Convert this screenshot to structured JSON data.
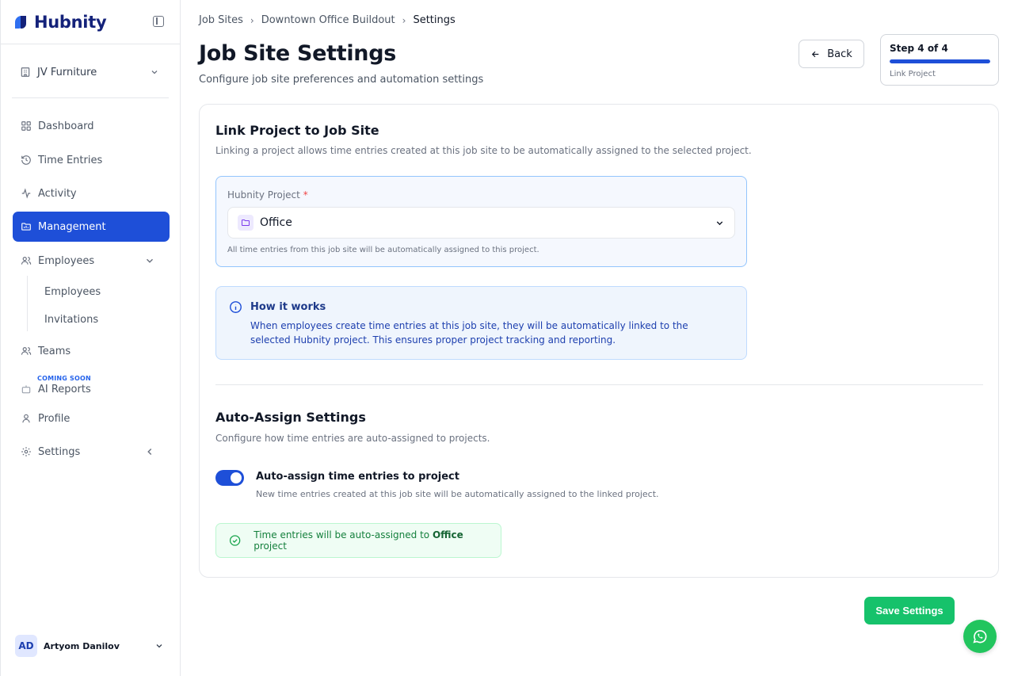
{
  "brand": {
    "name": "Hubnity"
  },
  "sidebar": {
    "org": "JV Furniture",
    "items": [
      {
        "label": "Dashboard",
        "icon": "grid-icon"
      },
      {
        "label": "Time Entries",
        "icon": "history-icon"
      },
      {
        "label": "Activity",
        "icon": "pulse-icon"
      },
      {
        "label": "Management",
        "icon": "folder-chart-icon"
      },
      {
        "label": "Employees",
        "icon": "users-icon"
      },
      {
        "label": "Teams",
        "icon": "users-icon"
      },
      {
        "label": "AI Reports",
        "icon": "bot-icon"
      },
      {
        "label": "Profile",
        "icon": "user-icon"
      },
      {
        "label": "Settings",
        "icon": "gear-icon"
      }
    ],
    "sub_items": [
      "Employees",
      "Invitations"
    ],
    "coming_soon": "COMING SOON",
    "user": {
      "initials": "AD",
      "name": "Artyom Danilov"
    }
  },
  "breadcrumb": [
    "Job Sites",
    "Downtown Office Buildout",
    "Settings"
  ],
  "page": {
    "title": "Job Site Settings",
    "subtitle": "Configure job site preferences and automation settings",
    "back_label": "Back",
    "step": {
      "title": "Step 4 of 4",
      "label": "Link Project",
      "progress": 1.0
    }
  },
  "link_section": {
    "title": "Link Project to Job Site",
    "description": "Linking a project allows time entries created at this job site to be automatically assigned to the selected project.",
    "field_label": "Hubnity Project",
    "required_mark": "*",
    "selected_value": "Office",
    "help": "All time entries from this job site will be automatically assigned to this project."
  },
  "info": {
    "title": "How it works",
    "text": "When employees create time entries at this job site, they will be automatically linked to the selected Hubnity project. This ensures proper project tracking and reporting."
  },
  "auto_section": {
    "title": "Auto-Assign Settings",
    "description": "Configure how time entries are auto-assigned to projects.",
    "toggle_label": "Auto-assign time entries to project",
    "toggle_desc": "New time entries created at this job site will be automatically assigned to the linked project.",
    "toggle_on": true,
    "success_prefix": "Time entries will be auto-assigned to",
    "success_project": "Office",
    "success_suffix": "project"
  },
  "actions": {
    "save_label": "Save Settings"
  },
  "colors": {
    "primary": "#1e4fd8",
    "success": "#16c26b",
    "brand_text": "#14227a"
  }
}
